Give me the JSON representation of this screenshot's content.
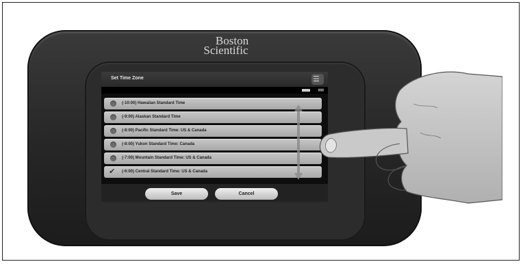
{
  "brand": {
    "line1": "Boston",
    "line2": "Scientific"
  },
  "screen": {
    "title": "Set Time Zone",
    "timezones": [
      {
        "label": "(-10:00) Hawaiian Standard Time",
        "selected": false
      },
      {
        "label": "(-9:00) Alaskan Standard Time",
        "selected": false
      },
      {
        "label": "(-8:00) Pacific Standard Time: US & Canada",
        "selected": false
      },
      {
        "label": "(-8:00) Yukon Standard Time: Canada",
        "selected": false
      },
      {
        "label": "(-7:00) Mountain Standard Time: US & Canada",
        "selected": false
      },
      {
        "label": "(-6:00) Central Standard Time: US & Canada",
        "selected": true
      }
    ],
    "save_label": "Save",
    "cancel_label": "Cancel",
    "title_icon": "menu-icon",
    "status_icons": [
      "battery-icon",
      "signal-icon"
    ]
  }
}
